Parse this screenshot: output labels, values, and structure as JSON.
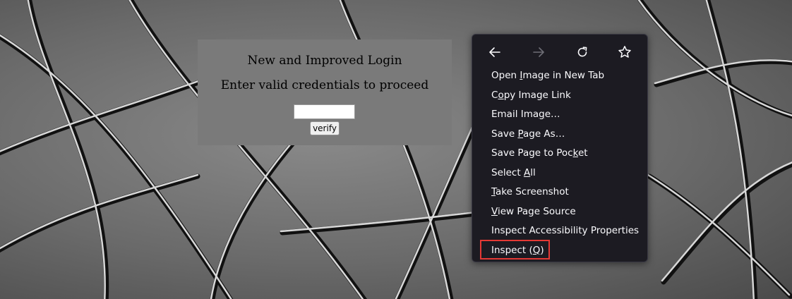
{
  "login": {
    "title": "New and Improved Login",
    "subtitle": "Enter valid credentials to proceed",
    "input_value": "",
    "verify_label": "verify"
  },
  "context_menu": {
    "nav": [
      {
        "name": "back-arrow-icon",
        "enabled": true
      },
      {
        "name": "forward-arrow-icon",
        "enabled": false
      },
      {
        "name": "reload-icon",
        "enabled": true
      },
      {
        "name": "bookmark-star-icon",
        "enabled": true
      }
    ],
    "items": [
      {
        "label": "Open Image in New Tab",
        "accesskey": "I"
      },
      {
        "label": "Copy Image Link",
        "accesskey": "o"
      },
      {
        "label": "Email Image…",
        "accesskey": "g"
      },
      {
        "label": "Save Page As…",
        "accesskey": "P"
      },
      {
        "label": "Save Page to Pocket",
        "accesskey": "k"
      },
      {
        "label": "Select All",
        "accesskey": "A"
      },
      {
        "label": "Take Screenshot",
        "accesskey": "T"
      },
      {
        "label": "View Page Source",
        "accesskey": "V"
      },
      {
        "label": "Inspect Accessibility Properties",
        "accesskey": ""
      },
      {
        "label": "Inspect (Q)",
        "accesskey": "Q"
      }
    ],
    "highlighted_item": "Inspect (Q)",
    "highlight_color": "#e53935"
  }
}
